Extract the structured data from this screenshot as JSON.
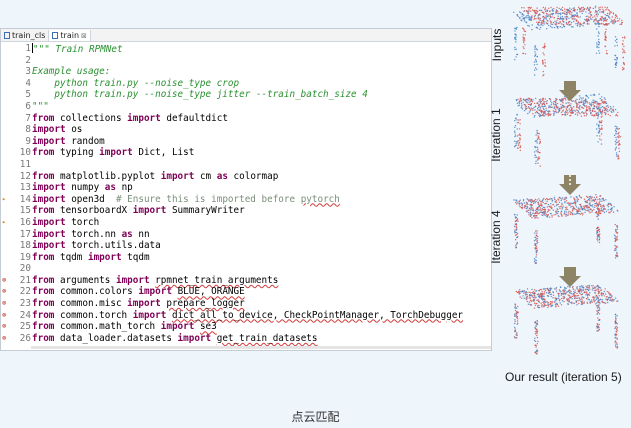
{
  "editor": {
    "tabs": [
      {
        "label": "train_cls"
      },
      {
        "label": "train"
      }
    ],
    "lines": [
      {
        "num": "1",
        "marker": "",
        "seg": [
          [
            "doc",
            "\"\"\" Train RPMNet"
          ]
        ]
      },
      {
        "num": "2",
        "marker": "",
        "seg": []
      },
      {
        "num": "3",
        "marker": "",
        "seg": [
          [
            "doc",
            "Example usage:"
          ]
        ]
      },
      {
        "num": "4",
        "marker": "",
        "seg": [
          [
            "doc",
            "    python train.py --noise_type crop"
          ]
        ]
      },
      {
        "num": "5",
        "marker": "",
        "seg": [
          [
            "doc",
            "    python train.py --noise_type jitter --train_batch_size 4"
          ]
        ]
      },
      {
        "num": "6",
        "marker": "",
        "seg": [
          [
            "doc",
            "\"\"\""
          ]
        ]
      },
      {
        "num": "7",
        "marker": "",
        "seg": [
          [
            "kw",
            "from"
          ],
          [
            "txt",
            " collections "
          ],
          [
            "kw",
            "import"
          ],
          [
            "txt",
            " defaultdict"
          ]
        ]
      },
      {
        "num": "8",
        "marker": "",
        "seg": [
          [
            "kw",
            "import"
          ],
          [
            "txt",
            " os"
          ]
        ]
      },
      {
        "num": "9",
        "marker": "",
        "seg": [
          [
            "kw",
            "import"
          ],
          [
            "txt",
            " random"
          ]
        ]
      },
      {
        "num": "10",
        "marker": "",
        "seg": [
          [
            "kw",
            "from"
          ],
          [
            "txt",
            " typing "
          ],
          [
            "kw",
            "import"
          ],
          [
            "txt",
            " Dict, List"
          ]
        ]
      },
      {
        "num": "11",
        "marker": "",
        "seg": []
      },
      {
        "num": "12",
        "marker": "",
        "seg": [
          [
            "kw",
            "from"
          ],
          [
            "txt",
            " matplotlib.pyplot "
          ],
          [
            "kw",
            "import"
          ],
          [
            "txt",
            " cm "
          ],
          [
            "kw",
            "as"
          ],
          [
            "txt",
            " colormap"
          ]
        ]
      },
      {
        "num": "13",
        "marker": "",
        "seg": [
          [
            "kw",
            "import"
          ],
          [
            "txt",
            " numpy "
          ],
          [
            "kw",
            "as"
          ],
          [
            "txt",
            " np"
          ]
        ]
      },
      {
        "num": "14",
        "marker": "warn",
        "seg": [
          [
            "kw",
            "import"
          ],
          [
            "txt",
            " open3d  "
          ],
          [
            "cmt",
            "# Ensure this is imported before "
          ],
          [
            "cmtsq",
            "pytorch"
          ]
        ]
      },
      {
        "num": "15",
        "marker": "",
        "seg": [
          [
            "kw",
            "from"
          ],
          [
            "txt",
            " tensorboardX "
          ],
          [
            "kw",
            "import"
          ],
          [
            "txt",
            " SummaryWriter"
          ]
        ]
      },
      {
        "num": "16",
        "marker": "warn",
        "seg": [
          [
            "kw",
            "import"
          ],
          [
            "txt",
            " torch"
          ]
        ]
      },
      {
        "num": "17",
        "marker": "",
        "seg": [
          [
            "kw",
            "import"
          ],
          [
            "txt",
            " torch.nn "
          ],
          [
            "kw",
            "as"
          ],
          [
            "txt",
            " nn"
          ]
        ]
      },
      {
        "num": "18",
        "marker": "",
        "seg": [
          [
            "kw",
            "import"
          ],
          [
            "txt",
            " torch.utils.data"
          ]
        ]
      },
      {
        "num": "19",
        "marker": "",
        "seg": [
          [
            "kw",
            "from"
          ],
          [
            "txt",
            " tqdm "
          ],
          [
            "kw",
            "import"
          ],
          [
            "txt",
            " tqdm"
          ]
        ]
      },
      {
        "num": "20",
        "marker": "",
        "seg": []
      },
      {
        "num": "21",
        "marker": "err",
        "seg": [
          [
            "kw",
            "from"
          ],
          [
            "txt",
            " arguments "
          ],
          [
            "kw",
            "import"
          ],
          [
            "txt",
            " "
          ],
          [
            "sq",
            "rpmnet_train_arguments"
          ]
        ]
      },
      {
        "num": "22",
        "marker": "err",
        "seg": [
          [
            "kw",
            "from"
          ],
          [
            "txt",
            " common.colors "
          ],
          [
            "kw",
            "import"
          ],
          [
            "txt",
            " "
          ],
          [
            "sq",
            "BLUE, ORANGE"
          ]
        ]
      },
      {
        "num": "23",
        "marker": "err",
        "seg": [
          [
            "kw",
            "from"
          ],
          [
            "txt",
            " common.misc "
          ],
          [
            "kw",
            "import"
          ],
          [
            "txt",
            " "
          ],
          [
            "sq",
            "prepare_logger"
          ]
        ]
      },
      {
        "num": "24",
        "marker": "err",
        "seg": [
          [
            "kw",
            "from"
          ],
          [
            "txt",
            " common.torch "
          ],
          [
            "kw",
            "import"
          ],
          [
            "txt",
            " "
          ],
          [
            "sq",
            "dict_all_to_device, CheckPointManager, TorchDebugger"
          ]
        ]
      },
      {
        "num": "25",
        "marker": "err",
        "seg": [
          [
            "kw",
            "from"
          ],
          [
            "txt",
            " common.math_torch "
          ],
          [
            "kw",
            "import"
          ],
          [
            "txt",
            " "
          ],
          [
            "sq",
            "se3"
          ]
        ]
      },
      {
        "num": "26",
        "marker": "err",
        "seg": [
          [
            "kw",
            "from"
          ],
          [
            "txt",
            " data_loader.datasets "
          ],
          [
            "kw",
            "import"
          ],
          [
            "txt",
            " "
          ],
          [
            "sq",
            "get_train_datasets"
          ]
        ]
      }
    ]
  },
  "figure": {
    "label_inputs": "Inputs",
    "label_iter1": "Iteration 1",
    "label_iter4": "Iteration 4",
    "result_label": "Our result (iteration 5)",
    "colors": {
      "red": "#d9534f",
      "blue": "#4a7fc1",
      "arrow": "#8d8465"
    }
  },
  "caption": "点云匹配"
}
